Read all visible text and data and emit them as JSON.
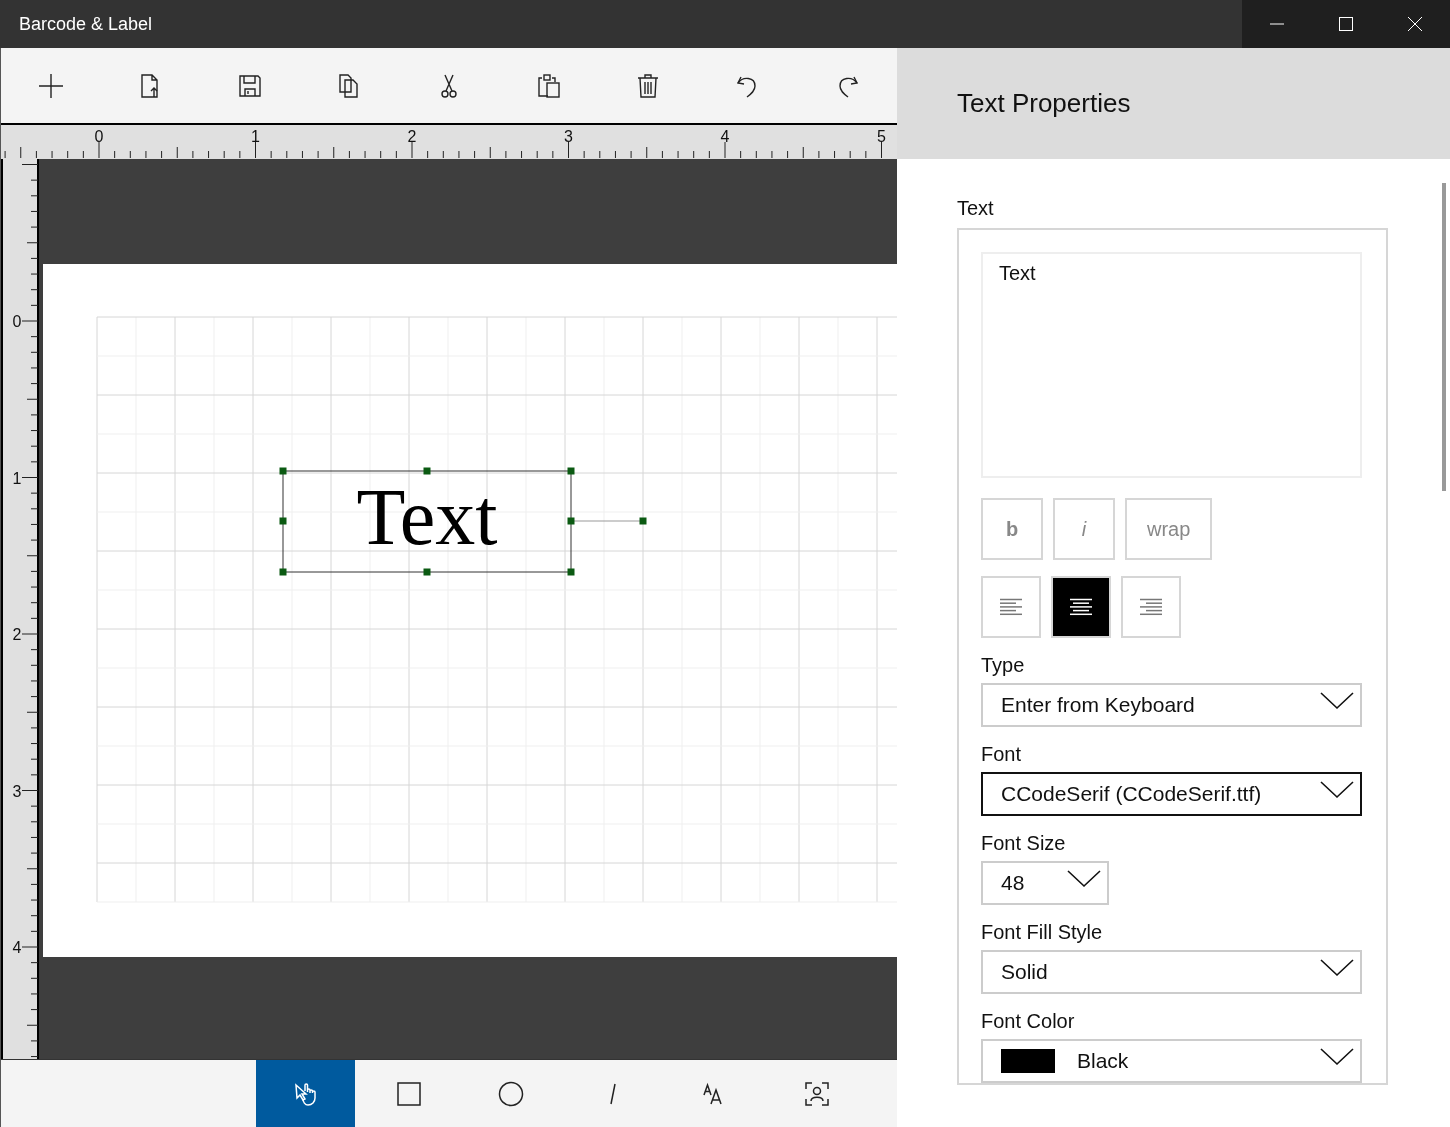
{
  "window": {
    "title": "Barcode & Label"
  },
  "toolbar": [
    {
      "kind": "add"
    },
    {
      "kind": "export"
    },
    {
      "kind": "save"
    },
    {
      "kind": "copy"
    },
    {
      "kind": "cut"
    },
    {
      "kind": "paste"
    },
    {
      "kind": "delete"
    },
    {
      "kind": "undo"
    },
    {
      "kind": "redo"
    }
  ],
  "rulers": {
    "horizontal": [
      "0",
      "1",
      "2",
      "3",
      "4",
      "5"
    ],
    "vertical": [
      "0",
      "1",
      "2",
      "3",
      "4"
    ]
  },
  "canvas": {
    "element": {
      "text": "Text",
      "selected": true
    }
  },
  "tools": [
    {
      "kind": "pointer",
      "selected": true
    },
    {
      "kind": "rectangle",
      "selected": false
    },
    {
      "kind": "ellipse",
      "selected": false
    },
    {
      "kind": "line",
      "selected": false
    },
    {
      "kind": "text",
      "selected": false
    },
    {
      "kind": "image",
      "selected": false
    }
  ],
  "panel": {
    "title": "Text Properties",
    "text_label": "Text",
    "text_value": "Text",
    "style_buttons": [
      {
        "label": "b",
        "kind": "bold",
        "checked": false
      },
      {
        "label": "i",
        "kind": "italic",
        "checked": false
      },
      {
        "label": "wrap",
        "kind": "wrap",
        "checked": false
      }
    ],
    "align_buttons": [
      {
        "kind": "left",
        "selected": false
      },
      {
        "kind": "center",
        "selected": true
      },
      {
        "kind": "right",
        "selected": false
      }
    ],
    "fields": [
      {
        "label": "Type",
        "value": "Enter from Keyboard",
        "kind": "wide",
        "focused": false
      },
      {
        "label": "Font",
        "value": "CCodeSerif (CCodeSerif.ttf)",
        "kind": "wide",
        "focused": true
      },
      {
        "label": "Font Size",
        "value": "48",
        "kind": "narrow",
        "focused": false
      },
      {
        "label": "Font Fill Style",
        "value": "Solid",
        "kind": "wide",
        "focused": false
      },
      {
        "label": "Font Color",
        "value": "Black",
        "kind": "swatch",
        "color": "#000000",
        "focused": false
      }
    ]
  }
}
